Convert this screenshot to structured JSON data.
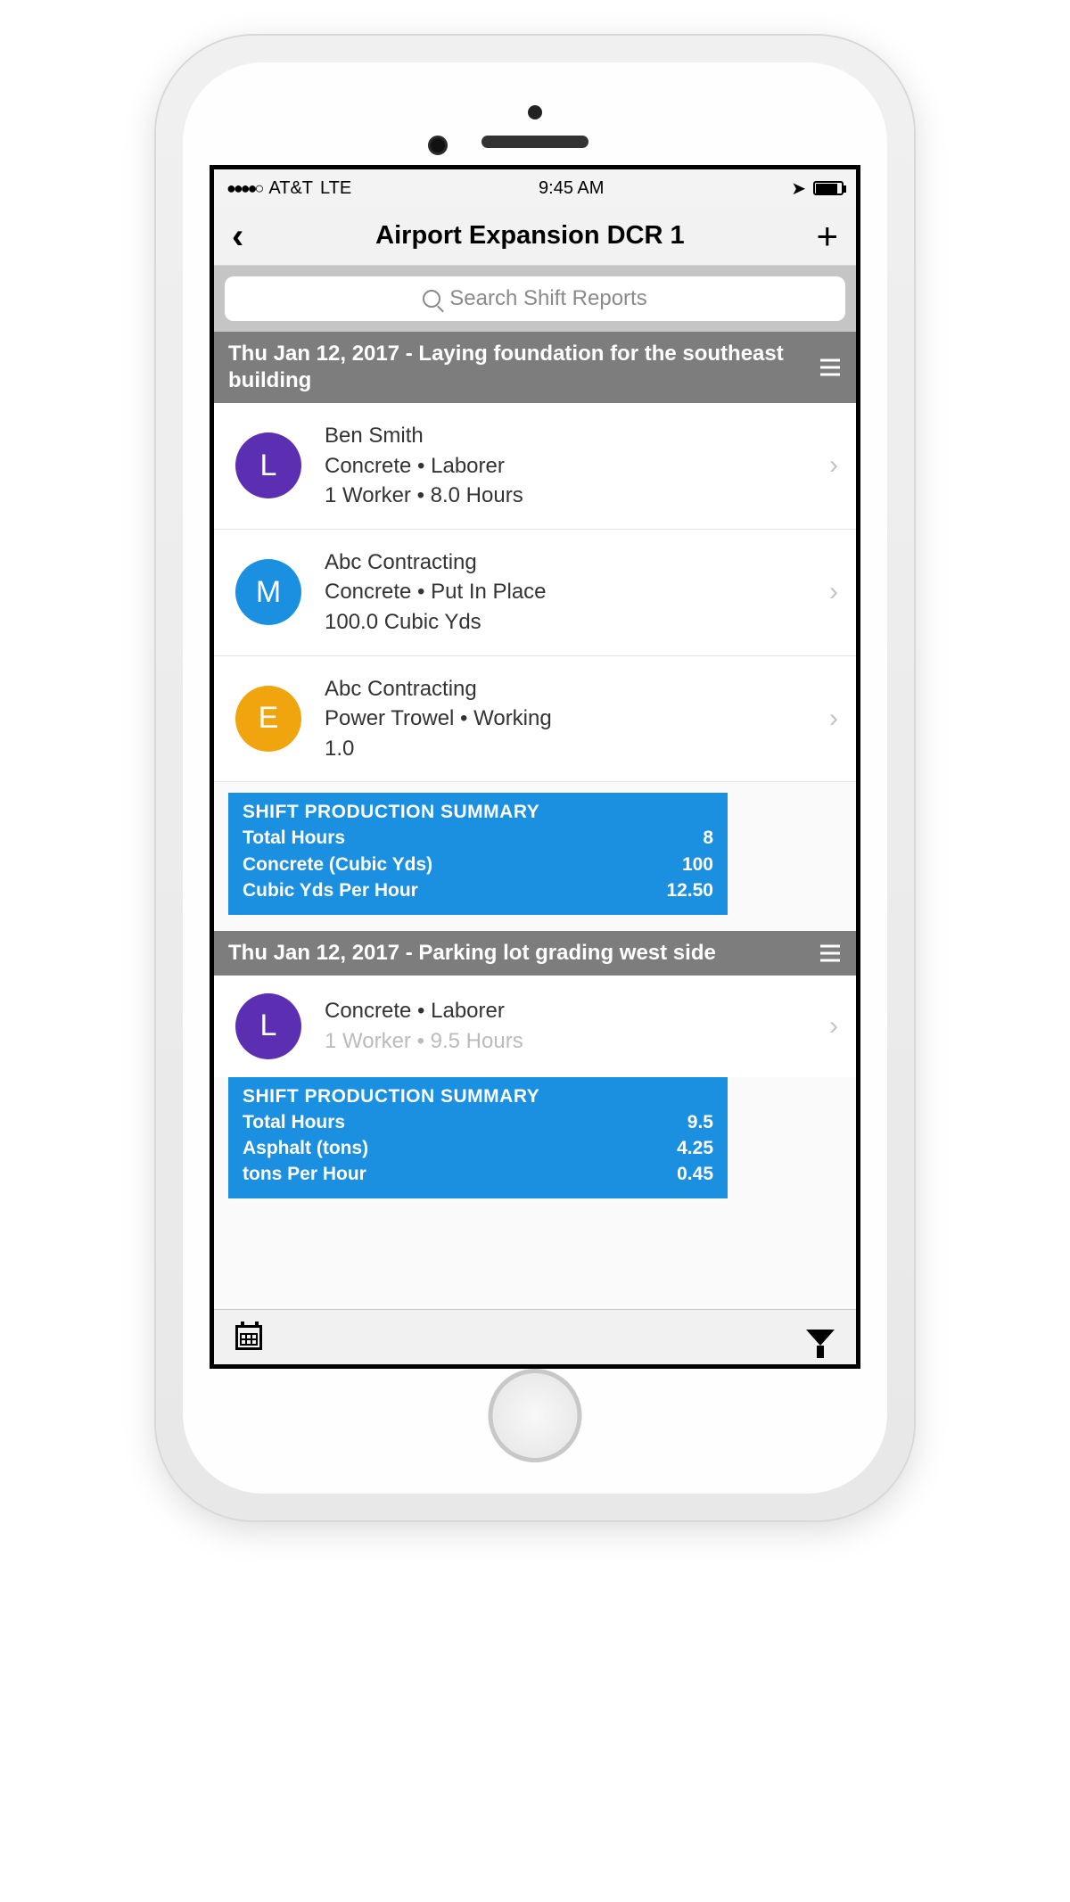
{
  "status": {
    "carrier": "AT&T",
    "network": "LTE",
    "time": "9:45 AM"
  },
  "nav": {
    "title": "Airport Expansion DCR 1"
  },
  "search": {
    "placeholder": "Search Shift Reports"
  },
  "sections": [
    {
      "title": "Thu Jan 12, 2017 - Laying foundation for the southeast building",
      "rows": [
        {
          "badge": "L",
          "color": "#5c2fb2",
          "line1": "Ben Smith",
          "line2": "Concrete • Laborer",
          "line3": "1 Worker • 8.0 Hours"
        },
        {
          "badge": "M",
          "color": "#1b8fe0",
          "line1": "Abc Contracting",
          "line2": "Concrete • Put In Place",
          "line3": "100.0 Cubic Yds"
        },
        {
          "badge": "E",
          "color": "#f0a40e",
          "line1": "Abc Contracting",
          "line2": "Power Trowel • Working",
          "line3": "1.0"
        }
      ],
      "summary": {
        "title": "SHIFT PRODUCTION SUMMARY",
        "rows": [
          {
            "label": "Total Hours",
            "value": "8"
          },
          {
            "label": "Concrete (Cubic Yds)",
            "value": "100"
          },
          {
            "label": "Cubic Yds Per Hour",
            "value": "12.50"
          }
        ]
      }
    },
    {
      "title": "Thu Jan 12, 2017 - Parking lot grading west side",
      "rows": [
        {
          "badge": "L",
          "color": "#5c2fb2",
          "line1": "",
          "line2": "Concrete • Laborer",
          "line3": "1 Worker • 9.5 Hours"
        }
      ],
      "summary": {
        "title": "SHIFT PRODUCTION SUMMARY",
        "rows": [
          {
            "label": "Total Hours",
            "value": "9.5"
          },
          {
            "label": "Asphalt (tons)",
            "value": "4.25"
          },
          {
            "label": "tons Per Hour",
            "value": "0.45"
          }
        ]
      }
    }
  ]
}
